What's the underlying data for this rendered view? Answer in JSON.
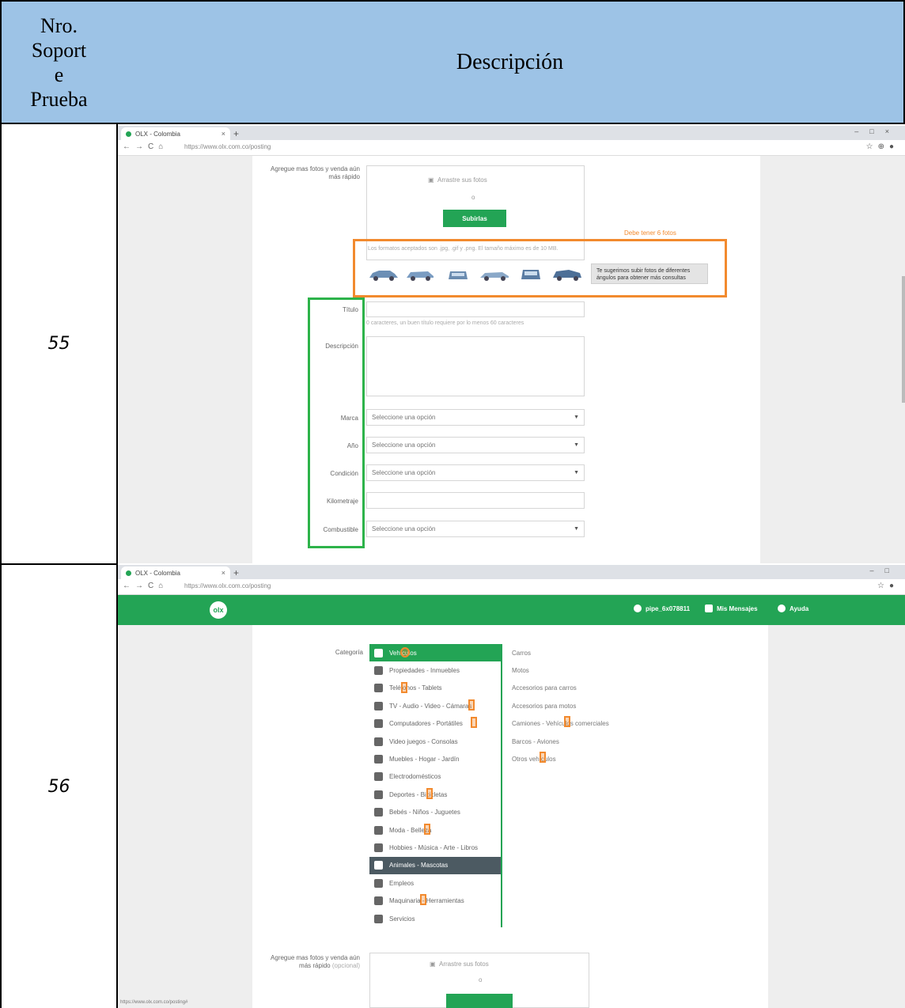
{
  "header": {
    "col1_lines": [
      "Nro.",
      "Soport",
      "e",
      "Prueba"
    ],
    "col2": "Descripción"
  },
  "rows": [
    {
      "number": "55",
      "browser": {
        "tab_title": "OLX - Colombia",
        "url": "https://www.olx.com.co/posting"
      },
      "form": {
        "photos_label": "Agregue mas fotos y venda aún más rápido",
        "photos_placeholder": "Arrastre sus fotos",
        "or_text": "o",
        "upload_button": "Subirlas",
        "orange_note": "Debe tener 6 fotos",
        "formats_hint": "Los formatos aceptados son .jpg, .gif y .png. El tamaño máximo es de 10 MB.",
        "tooltip": "Te sugerimos subir fotos de diferentes ángulos para obtener más consultas",
        "fields": [
          {
            "label": "Título",
            "value": "",
            "type": "text"
          },
          {
            "label": "Descripción",
            "value": "",
            "type": "textarea"
          },
          {
            "label": "Marca",
            "value": "Seleccione una opción",
            "type": "select"
          },
          {
            "label": "Año",
            "value": "Seleccione una opción",
            "type": "select"
          },
          {
            "label": "Condición",
            "value": "Seleccione una opción",
            "type": "select"
          },
          {
            "label": "Kilometraje",
            "value": "",
            "type": "text"
          },
          {
            "label": "Combustible",
            "value": "Seleccione una opción",
            "type": "select"
          }
        ],
        "title_hint": "0 caracteres, un buen título requiere por lo menos 60 caracteres"
      }
    },
    {
      "number": "56",
      "browser": {
        "tab_title": "OLX - Colombia",
        "url": "https://www.olx.com.co/posting"
      },
      "topnav": {
        "logo": "olx",
        "user": "pipe_6x078811",
        "messages": "Mis Mensajes",
        "help": "Ayuda"
      },
      "category_label": "Categoría",
      "categories": [
        "Vehículos",
        "Propiedades - Inmuebles",
        "Teléfonos - Tablets",
        "TV - Audio - Video - Cámaras",
        "Computadores - Portátiles",
        "Video juegos - Consolas",
        "Muebles - Hogar - Jardín",
        "Electrodomésticos",
        "Deportes - Bicicletas",
        "Bebés - Niños - Juguetes",
        "Moda - Belleza",
        "Hobbies - Música - Arte - Libros",
        "Animales - Mascotas",
        "Empleos",
        "Maquinaria - Herramientas",
        "Servicios"
      ],
      "subcategories": [
        "Carros",
        "Motos",
        "Accesorios para carros",
        "Accesorios para motos",
        "Camiones - Vehículos comerciales",
        "Barcos - Aviones",
        "Otros vehículos"
      ],
      "photos_label": "Agregue mas fotos y venda aún más rápido",
      "photos_optional": "(opcional)",
      "photos_placeholder": "Arrastre sus fotos",
      "or_text": "o",
      "status_url": "https://www.olx.com.co/posting#"
    }
  ]
}
